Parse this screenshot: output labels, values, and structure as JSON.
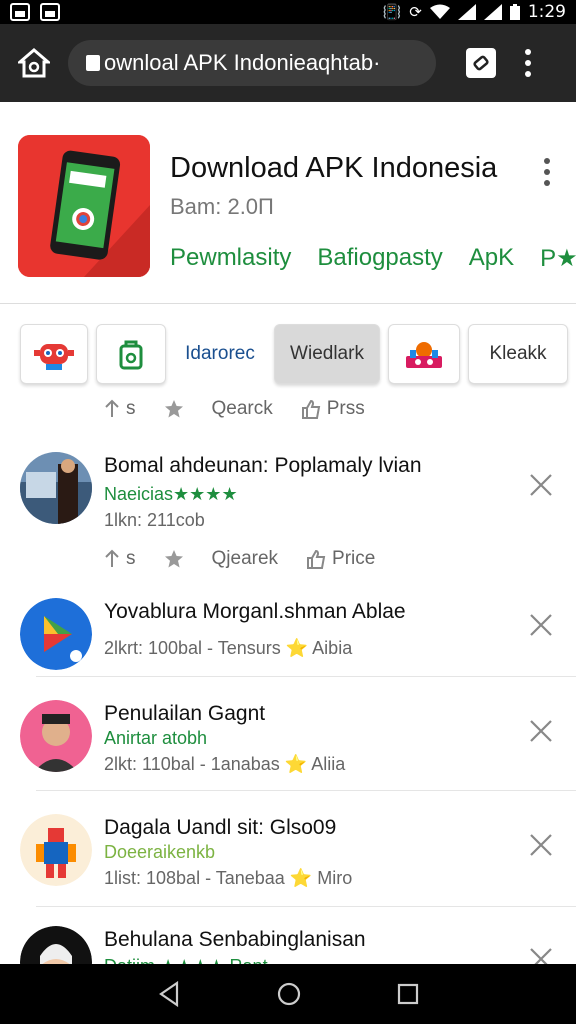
{
  "status_bar": {
    "time": "1:29"
  },
  "browser": {
    "url": "ownloal APK Indonieaqhtab·"
  },
  "app": {
    "title": "Download APK Indonesia",
    "version": "Bam: 2.0П",
    "links": [
      "Pewmlasity",
      "Bafiogpasty",
      "ApK",
      "P★"
    ]
  },
  "chips": [
    {
      "label": "",
      "icon": "robot-icon"
    },
    {
      "label": "",
      "icon": "android-bag-icon"
    },
    {
      "label": "Idarorec"
    },
    {
      "label": "Wiedlark"
    },
    {
      "label": "",
      "icon": "mosque-icon"
    },
    {
      "label": "Kleakk"
    }
  ],
  "actions_top": {
    "share": "s",
    "star": "",
    "search": "Qearck",
    "like": "Prss"
  },
  "actions_mid": {
    "share": "s",
    "star": "",
    "search": "Qjearek",
    "like": "Price"
  },
  "items": [
    {
      "title": "Bomal ahdeunan: Poplamaly lvian",
      "sub": "Naeicias★★★★",
      "meta": "1lkn: 211cob"
    },
    {
      "title": "Yovablura Morganl.shman Ablae",
      "meta": "2lkrt: 100bal - Tensurs ⭐ Aibia"
    },
    {
      "title": "Penulailan Gagnt",
      "sub": "Anirtar atobh",
      "meta": "2lkt: 110bal - 1anabas ⭐ Aliia"
    },
    {
      "title": "Dagala Uandl sit: Glso09",
      "sub": "Doeeraikenkb",
      "meta": "1list: 108bal - Tanebaa ⭐ Miro"
    },
    {
      "title": "Behulana Senbabinglanisan",
      "sub": "Datiim ★★★★ Rant"
    }
  ],
  "colors": {
    "accent_green": "#1e8e3e",
    "browser_bar": "#262626",
    "app_icon_red": "#e8352f"
  }
}
